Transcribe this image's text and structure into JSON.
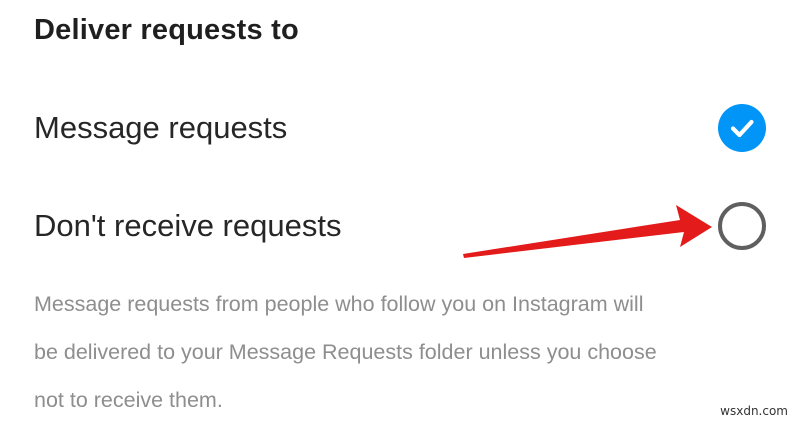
{
  "section": {
    "title": "Deliver requests to"
  },
  "options": [
    {
      "label": "Message requests",
      "selected": true
    },
    {
      "label": "Don't receive requests",
      "selected": false
    }
  ],
  "helper": {
    "lines": [
      "Message requests from people who follow you on Instagram will",
      "be delivered to your Message Requests folder unless you choose",
      "not to receive them."
    ]
  },
  "colors": {
    "accent": "#0095f6",
    "arrow": "#e31b1b",
    "helper_text": "#8e8e8e"
  },
  "icons": {
    "selected": "checkmark-icon",
    "unselected": "empty-radio-icon"
  },
  "watermark": "wsxdn.com"
}
